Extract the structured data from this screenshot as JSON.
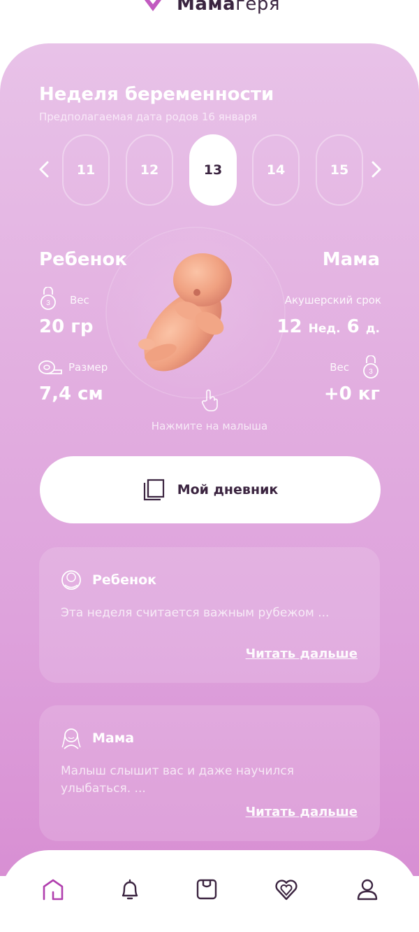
{
  "logo": {
    "bold": "Мама",
    "light": "геря"
  },
  "pregnancy": {
    "title": "Неделя беременности",
    "subtitle": "Предполагаемая дата родов  16 января"
  },
  "weeks": {
    "items": [
      "11",
      "12",
      "13",
      "14",
      "15"
    ],
    "selected": "13"
  },
  "baby": {
    "title": "Ребенок",
    "weight_label": "Вес",
    "weight_value": "20 гр",
    "size_label": "Размер",
    "size_value": "7,4 см"
  },
  "mom": {
    "title": "Мама",
    "term_label": "Акушерский срок",
    "term_weeks": "12",
    "term_weeks_unit": "Нед.",
    "term_days": "6",
    "term_days_unit": "д.",
    "weight_label": "Вес",
    "weight_value": "+0 кг"
  },
  "hint": "Нажмите на малыша",
  "diary": {
    "label": "Мой дневник"
  },
  "cards": [
    {
      "title": "Ребенок",
      "text": "Эта неделя считается важным рубежом ...",
      "link": "Читать дальше",
      "icon": "baby-face-icon"
    },
    {
      "title": "Мама",
      "text": "Малыш слышит вас и даже научился улыбаться. ...",
      "link": "Читать дальше",
      "icon": "mother-icon"
    }
  ],
  "nav": {
    "items": [
      "home-icon",
      "bell-icon",
      "calendar-icon",
      "heart-spiral-icon",
      "profile-icon"
    ],
    "active": "home-icon"
  },
  "colors": {
    "accent": "#b03fae",
    "dark": "#3b2440",
    "gradient_top": "#e8c2e8",
    "gradient_bottom": "#d88fd3"
  }
}
